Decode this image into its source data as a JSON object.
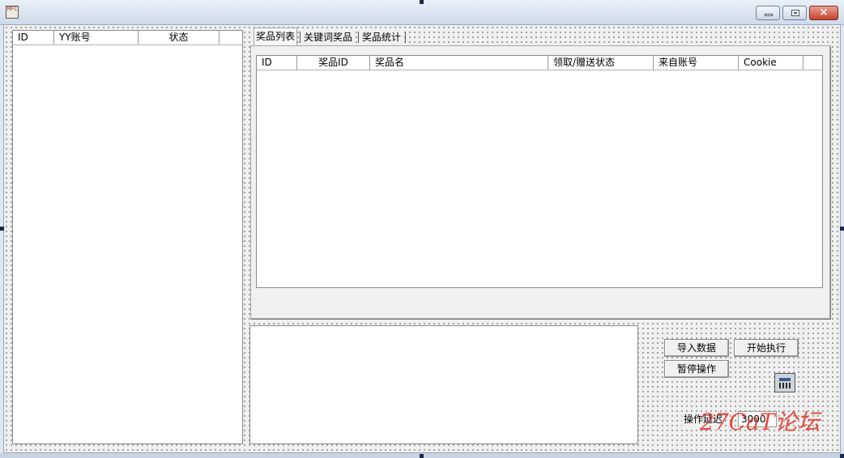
{
  "window": {
    "app_icon_text": "MFC",
    "minimize_label": "",
    "maximize_label": "",
    "close_label": "×"
  },
  "account_list": {
    "columns": [
      "ID",
      "YY账号",
      "状态"
    ],
    "rows": []
  },
  "tabs": [
    {
      "label": "奖品列表",
      "active": true
    },
    {
      "label": "关键词奖品",
      "active": false
    },
    {
      "label": "奖品统计",
      "active": false
    }
  ],
  "prize_list": {
    "columns": [
      "ID",
      "奖品ID",
      "奖品名",
      "领取/赠送状态",
      "来自账号",
      "Cookie"
    ],
    "rows": []
  },
  "log_box": {
    "text": ""
  },
  "buttons": {
    "import": "导入数据",
    "start": "开始执行",
    "pause": "暂停操作"
  },
  "delay": {
    "label": "操作延迟",
    "value": "3000"
  },
  "watermark": "27CaT论坛",
  "colors": {
    "watermark": "#e43a2c",
    "close_button": "#c8422e",
    "title_gradient_top": "#e9f0f8"
  }
}
